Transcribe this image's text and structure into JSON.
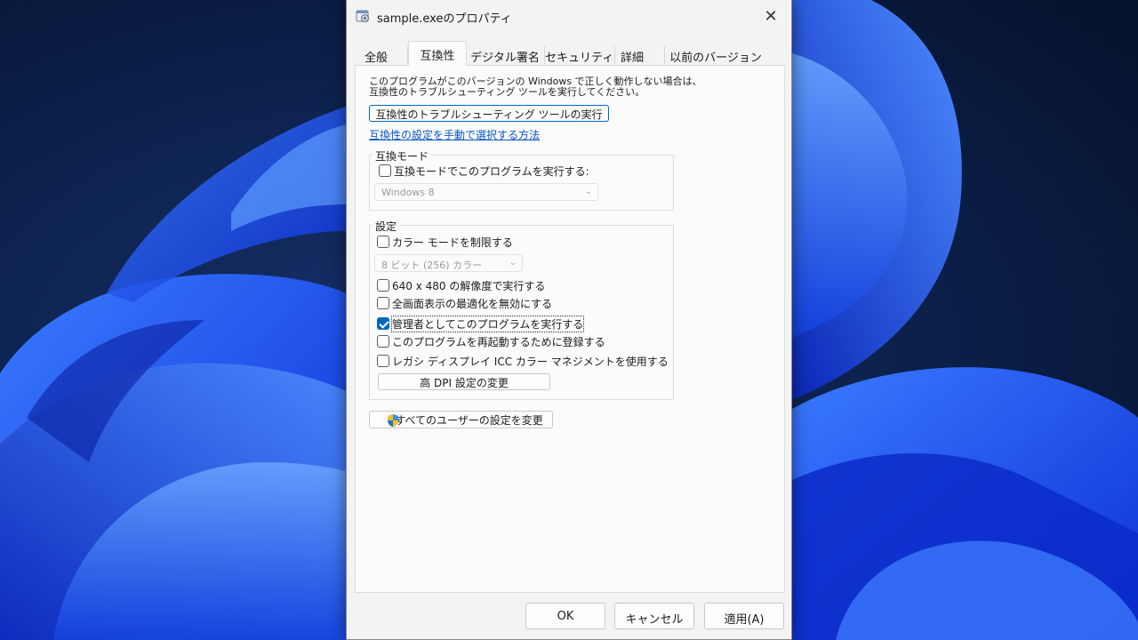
{
  "window": {
    "title": "sample.exeのプロパティ",
    "close_glyph": "✕"
  },
  "tabs": [
    {
      "label": "全般"
    },
    {
      "label": "互換性",
      "active": true
    },
    {
      "label": "デジタル署名"
    },
    {
      "label": "セキュリティ"
    },
    {
      "label": "詳細"
    },
    {
      "label": "以前のバージョン"
    }
  ],
  "compat": {
    "intro_line1": "このプログラムがこのバージョンの Windows で正しく動作しない場合は、",
    "intro_line2": "互換性のトラブルシューティング ツールを実行してください。",
    "troubleshooter_button": "互換性のトラブルシューティング ツールの実行",
    "manual_link": "互換性の設定を手動で選択する方法",
    "mode_group": {
      "label": "互換モード",
      "checkbox_label": "互換モードでこのプログラムを実行する:",
      "checked": false,
      "select_value": "Windows 8"
    },
    "settings_group": {
      "label": "設定",
      "reduced_color": {
        "label": "カラー モードを制限する",
        "checked": false
      },
      "color_select_value": "8 ビット (256) カラー",
      "res_640": {
        "label": "640 x 480 の解像度で実行する",
        "checked": false
      },
      "disable_fullscreen_opt": {
        "label": "全画面表示の最適化を無効にする",
        "checked": false
      },
      "run_as_admin": {
        "label": "管理者としてこのプログラムを実行する",
        "checked": true
      },
      "register_restart": {
        "label": "このプログラムを再起動するために登録する",
        "checked": false
      },
      "legacy_icc": {
        "label": "レガシ ディスプレイ ICC カラー マネジメントを使用する",
        "checked": false
      },
      "high_dpi_button": "高 DPI 設定の変更"
    },
    "all_users_button": "すべてのユーザーの設定を変更"
  },
  "footer": {
    "ok": "OK",
    "cancel": "キャンセル",
    "apply": "適用(A)"
  },
  "icons": {
    "app_icon": "properties-icon",
    "shield": "uac-shield-icon",
    "chevron": "chevron-down-icon"
  },
  "colors": {
    "accent": "#0067c0",
    "link": "#0b57c7",
    "dialog_bg": "#f3f3f3",
    "panel_bg": "#fbfbfb",
    "wallpaper_dark": "#06132e",
    "wallpaper_blue": "#1f5bff"
  }
}
